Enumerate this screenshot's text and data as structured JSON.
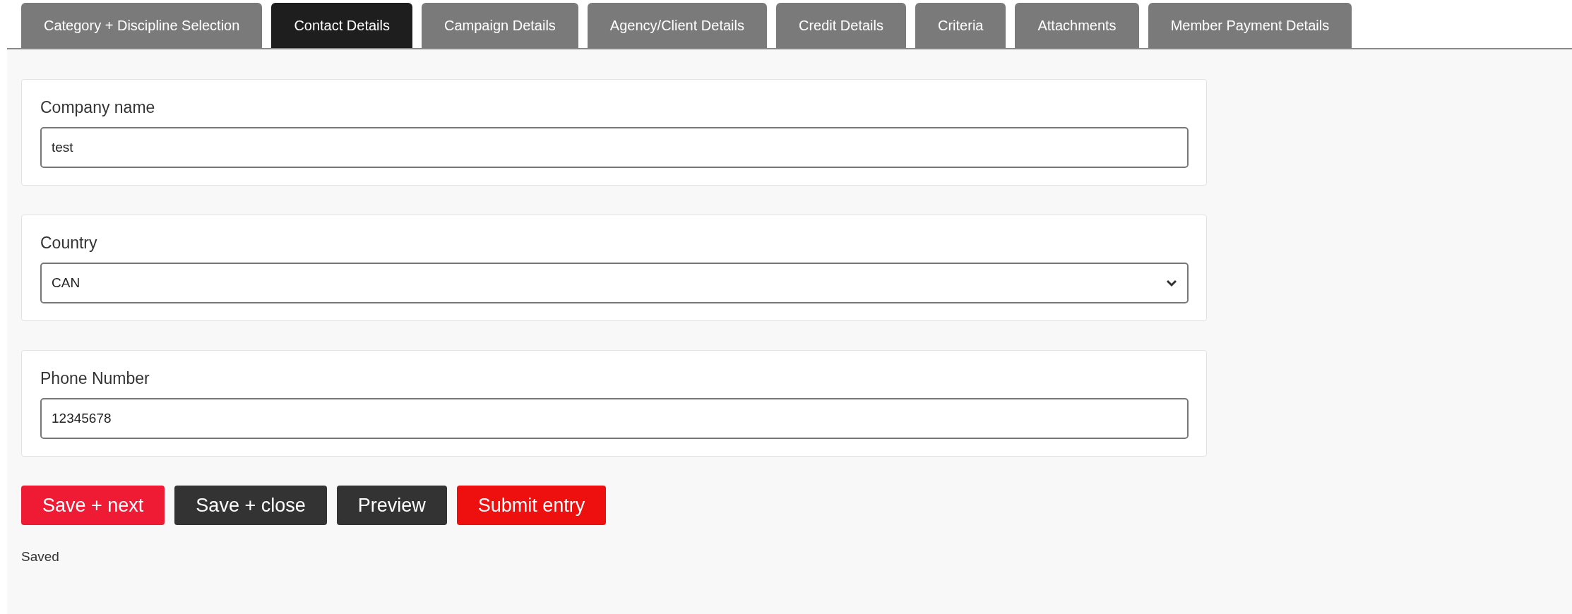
{
  "tabs": [
    {
      "label": "Category + Discipline Selection",
      "selected": false
    },
    {
      "label": "Contact Details",
      "selected": true
    },
    {
      "label": "Campaign Details",
      "selected": false
    },
    {
      "label": "Agency/Client Details",
      "selected": false
    },
    {
      "label": "Credit Details",
      "selected": false
    },
    {
      "label": "Criteria",
      "selected": false
    },
    {
      "label": "Attachments",
      "selected": false
    },
    {
      "label": "Member Payment Details",
      "selected": false
    }
  ],
  "fields": [
    {
      "kind": "text",
      "label": "Company name",
      "value": "test"
    },
    {
      "kind": "select",
      "label": "Country",
      "value": "CAN"
    },
    {
      "kind": "text",
      "label": "Phone Number",
      "value": "12345678"
    }
  ],
  "buttons": [
    {
      "kind": "next",
      "label": "Save + next"
    },
    {
      "kind": "dark",
      "label": "Save + close"
    },
    {
      "kind": "dark",
      "label": "Preview"
    },
    {
      "kind": "submit",
      "label": "Submit entry"
    }
  ],
  "status": "Saved"
}
